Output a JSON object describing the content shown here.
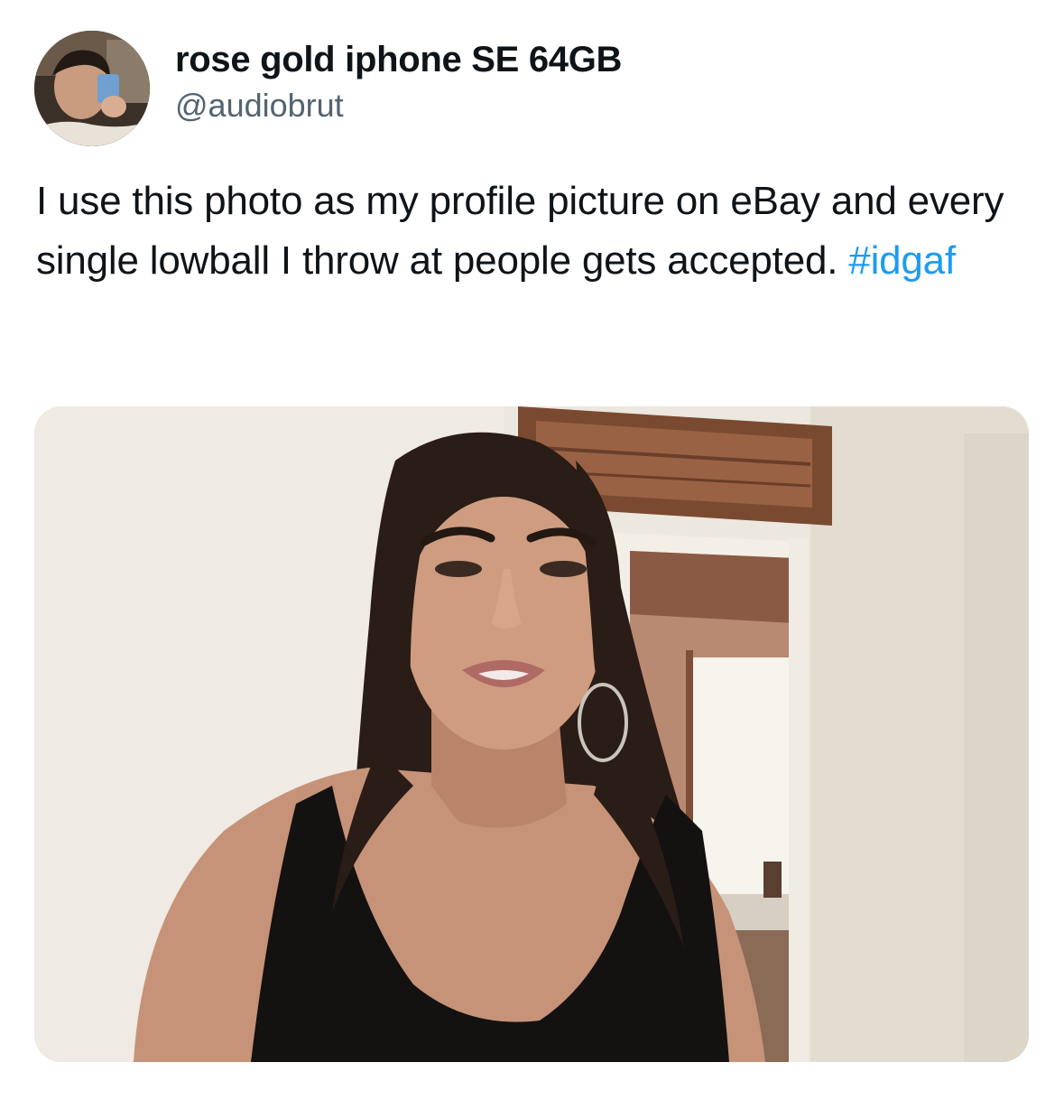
{
  "tweet": {
    "author": {
      "display_name": "rose gold iphone SE 64GB",
      "handle": "@audiobrut",
      "avatar_icon": "profile-photo-icon"
    },
    "text": {
      "body": "I use this photo as my profile picture on eBay and every single lowball I throw at people gets accepted. ",
      "hashtag": "#idgaf"
    },
    "media": {
      "kind": "photo",
      "icon": "photo-of-woman-selfie"
    }
  },
  "colors": {
    "text": "#0f1419",
    "secondary_text": "#536471",
    "hashtag": "#1d9bf0",
    "background": "#ffffff"
  }
}
